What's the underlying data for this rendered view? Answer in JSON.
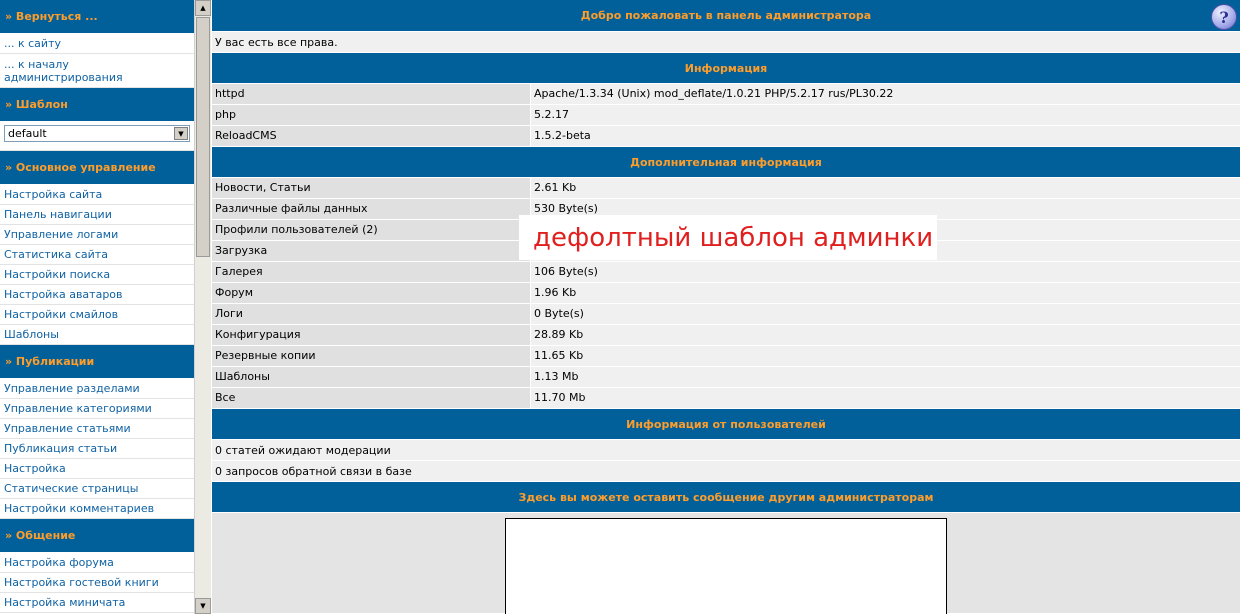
{
  "sidebar": {
    "back": {
      "heading": "» Вернуться ...",
      "items": [
        "... к сайту",
        "... к началу администрирования"
      ]
    },
    "template": {
      "heading": "» Шаблон",
      "selected": "default"
    },
    "main_control": {
      "heading": "» Основное управление",
      "items": [
        "Настройка сайта",
        "Панель навигации",
        "Управление логами",
        "Статистика сайта",
        "Настройки поиска",
        "Настройка аватаров",
        "Настройки смайлов",
        "Шаблоны"
      ]
    },
    "publications": {
      "heading": "» Публикации",
      "items": [
        "Управление разделами",
        "Управление категориями",
        "Управление статьями",
        "Публикация статьи",
        "Настройка",
        "Статические страницы",
        "Настройки комментариев"
      ]
    },
    "communication": {
      "heading": "» Общение",
      "items": [
        "Настройка форума",
        "Настройка гостевой книги",
        "Настройка миничата"
      ]
    }
  },
  "main": {
    "welcome_heading": "Добро пожаловать в панель администратора",
    "rights_text": "У вас есть все права.",
    "info": {
      "heading": "Информация",
      "rows": [
        {
          "key": "httpd",
          "value": "Apache/1.3.34 (Unix) mod_deflate/1.0.21 PHP/5.2.17 rus/PL30.22"
        },
        {
          "key": "php",
          "value": "5.2.17"
        },
        {
          "key": "ReloadCMS",
          "value": "1.5.2-beta"
        }
      ]
    },
    "extra": {
      "heading": "Дополнительная информация",
      "rows": [
        {
          "key": "Новости, Статьи",
          "value": "2.61 Kb"
        },
        {
          "key": "Различные файлы данных",
          "value": "530 Byte(s)"
        },
        {
          "key": "Профили пользователей (2)",
          "value": ""
        },
        {
          "key": "Загрузка",
          "value": ""
        },
        {
          "key": "Галерея",
          "value": "106 Byte(s)"
        },
        {
          "key": "Форум",
          "value": "1.96 Kb"
        },
        {
          "key": "Логи",
          "value": "0 Byte(s)"
        },
        {
          "key": "Конфигурация",
          "value": "28.89 Kb"
        },
        {
          "key": "Резервные копии",
          "value": "11.65 Kb"
        },
        {
          "key": "Шаблоны",
          "value": "1.13 Mb"
        },
        {
          "key": "Все",
          "value": "11.70 Mb"
        }
      ]
    },
    "user_info": {
      "heading": "Информация от пользователей",
      "lines": [
        "0 статей ожидают модерации",
        "0 запросов обратной связи в базе"
      ]
    },
    "message": {
      "heading": "Здесь вы можете оставить сообщение другим администраторам",
      "text": ""
    }
  },
  "annotation": "дефолтный шаблон админки",
  "icons": {
    "help": "help-question-icon",
    "scroll_up": "scroll-up-arrow-icon",
    "scroll_down": "scroll-down-arrow-icon",
    "select_arrow": "dropdown-arrow-icon"
  },
  "colors": {
    "header_bg": "#01609a",
    "header_text": "#ff9d2a",
    "link": "#1062a3",
    "annotation": "#e0201f"
  }
}
